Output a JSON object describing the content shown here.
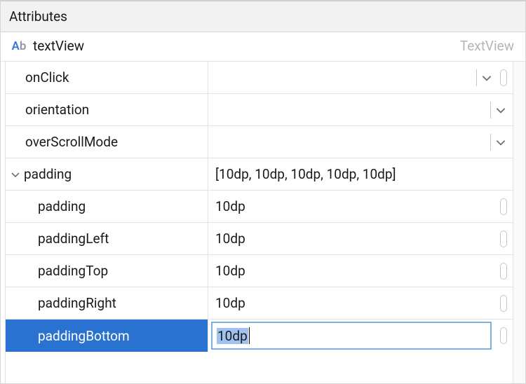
{
  "panel": {
    "title": "Attributes"
  },
  "component": {
    "id_label": "textView",
    "type_label": "TextView"
  },
  "rows": {
    "onClick": {
      "label": "onClick",
      "value": ""
    },
    "orientation": {
      "label": "orientation",
      "value": ""
    },
    "overScrollMode": {
      "label": "overScrollMode",
      "value": ""
    },
    "padding_group": {
      "label": "padding",
      "summary": "[10dp, 10dp, 10dp, 10dp, 10dp]"
    },
    "padding": {
      "label": "padding",
      "value": "10dp"
    },
    "paddingLeft": {
      "label": "paddingLeft",
      "value": "10dp"
    },
    "paddingTop": {
      "label": "paddingTop",
      "value": "10dp"
    },
    "paddingRight": {
      "label": "paddingRight",
      "value": "10dp"
    },
    "paddingBottom": {
      "label": "paddingBottom",
      "value": "10dp"
    }
  }
}
